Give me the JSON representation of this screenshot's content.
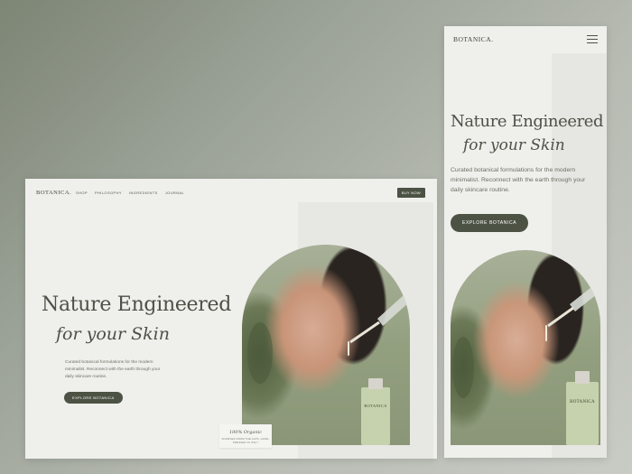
{
  "brand": "BOTANICA.",
  "desktop": {
    "nav": [
      "SHOP",
      "PHILOSOPHY",
      "INGREDIENTS",
      "JOURNAL"
    ],
    "buy_label": "BUY NOW",
    "headline_1": "Nature Engineered",
    "headline_2": "for your Skin",
    "description": "Curated botanical formulations for the modern minimalist. Reconnect with the earth through your daily skincare routine.",
    "cta": "EXPLORE BOTANICA",
    "badge_title": "100% Organic",
    "badge_sub": "SOURCED FROM THE ALPS, HAND-PRESSED IN ITALY",
    "bottle_label": "BOTANICA"
  },
  "mobile": {
    "headline_1": "Nature Engineered",
    "headline_2": "for your Skin",
    "description": "Curated botanical formulations for the modern minimalist. Reconnect with the earth through your daily skincare routine.",
    "cta": "EXPLORE BOTANICA",
    "bottle_label": "BOTANICA"
  },
  "icons": {
    "menu": "hamburger-menu-icon"
  },
  "colors": {
    "accent": "#4c5344",
    "bottle": "#c6d1ad",
    "background": "#efefec"
  }
}
